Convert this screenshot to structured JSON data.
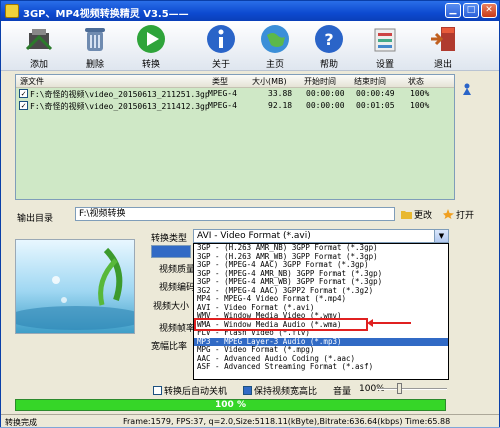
{
  "app": {
    "title": "3GP、MP4视频转换精灵 V3.5——"
  },
  "titlebar_buttons": {
    "minimize": "▁",
    "maximize": "□",
    "close": "✕"
  },
  "toolbar": {
    "add": "添加",
    "delete": "删除",
    "convert": "转换",
    "about": "关于",
    "home": "主页",
    "help": "帮助",
    "settings": "设置",
    "exit": "退出"
  },
  "file_list": {
    "headers": {
      "source": "源文件",
      "type": "类型",
      "size": "大小(MB)",
      "start": "开始时间",
      "end": "结束时间",
      "status": "状态"
    },
    "rows": [
      {
        "checked": "✓",
        "name": "F:\\奇怪的视频\\video_20150613_211251.3gp",
        "type": "MPEG-4",
        "size": "33.88",
        "start": "00:00:00",
        "end": "00:00:49",
        "status": "100%"
      },
      {
        "checked": "✓",
        "name": "F:\\奇怪的视频\\video_20150613_211412.3gp",
        "type": "MPEG-4",
        "size": "92.18",
        "start": "00:00:00",
        "end": "00:01:05",
        "status": "100%"
      }
    ]
  },
  "output": {
    "label": "输出目录",
    "path": "F:\\视频转换",
    "change": "更改",
    "open": "打开"
  },
  "settings": {
    "convert_type_label": "转换类型",
    "convert_type_value": "AVI - Video Format (*.avi)",
    "video_quality": "视频质量",
    "video_codec": "视频编码",
    "video_size": "视频大小",
    "video_fps": "视频帧率",
    "aspect": "宽幅比率"
  },
  "dropdown_items": [
    "3GP - (H.263 AMR_NB) 3GPP Format (*.3gp)",
    "3GP - (H.263 AMR_WB) 3GPP Format (*.3gp)",
    "3GP - (MPEG-4 AAC) 3GPP Format (*.3gp)",
    "3GP - (MPEG-4 AMR_NB) 3GPP Format (*.3gp)",
    "3GP - (MPEG-4 AMR_WB) 3GPP Format (*.3gp)",
    "3G2 - (MPEG-4 AAC) 3GPP2 Format (*.3g2)",
    "MP4 - MPEG-4 Video Format (*.mp4)",
    "AVI - Video Format (*.avi)",
    "WMV - Window Media Video (*.wmv)",
    "WMA - Window Media Audio (*.wma)",
    "FLV - Flash Video (*.flv)",
    "MP3 - MPEG Layer-3 Audio (*.mp3)",
    "MPG - Video Format (*.mpg)",
    "AAC - Advanced Audio Coding (*.aac)",
    "ASF - Advanced Streaming Format (*.asf)"
  ],
  "options": {
    "shutdown": "转换后自动关机",
    "keep_ratio": "保持视频宽高比",
    "volume_label": "音量",
    "volume_value": "100%"
  },
  "progress": {
    "text": "100 %",
    "value": 1.0
  },
  "status": {
    "left": "转换完成",
    "info": "Frame:1579, FPS:37, q=2.0,Size:5118.11(kByte),Bitrate:636.64(kbps) Time:65.88"
  },
  "colors": {
    "progress": "#36d628",
    "title_bar": "#0d4ad0",
    "list_bg": "#cfe8c6",
    "highlight": "#316ac5",
    "marker": "#e02020"
  }
}
